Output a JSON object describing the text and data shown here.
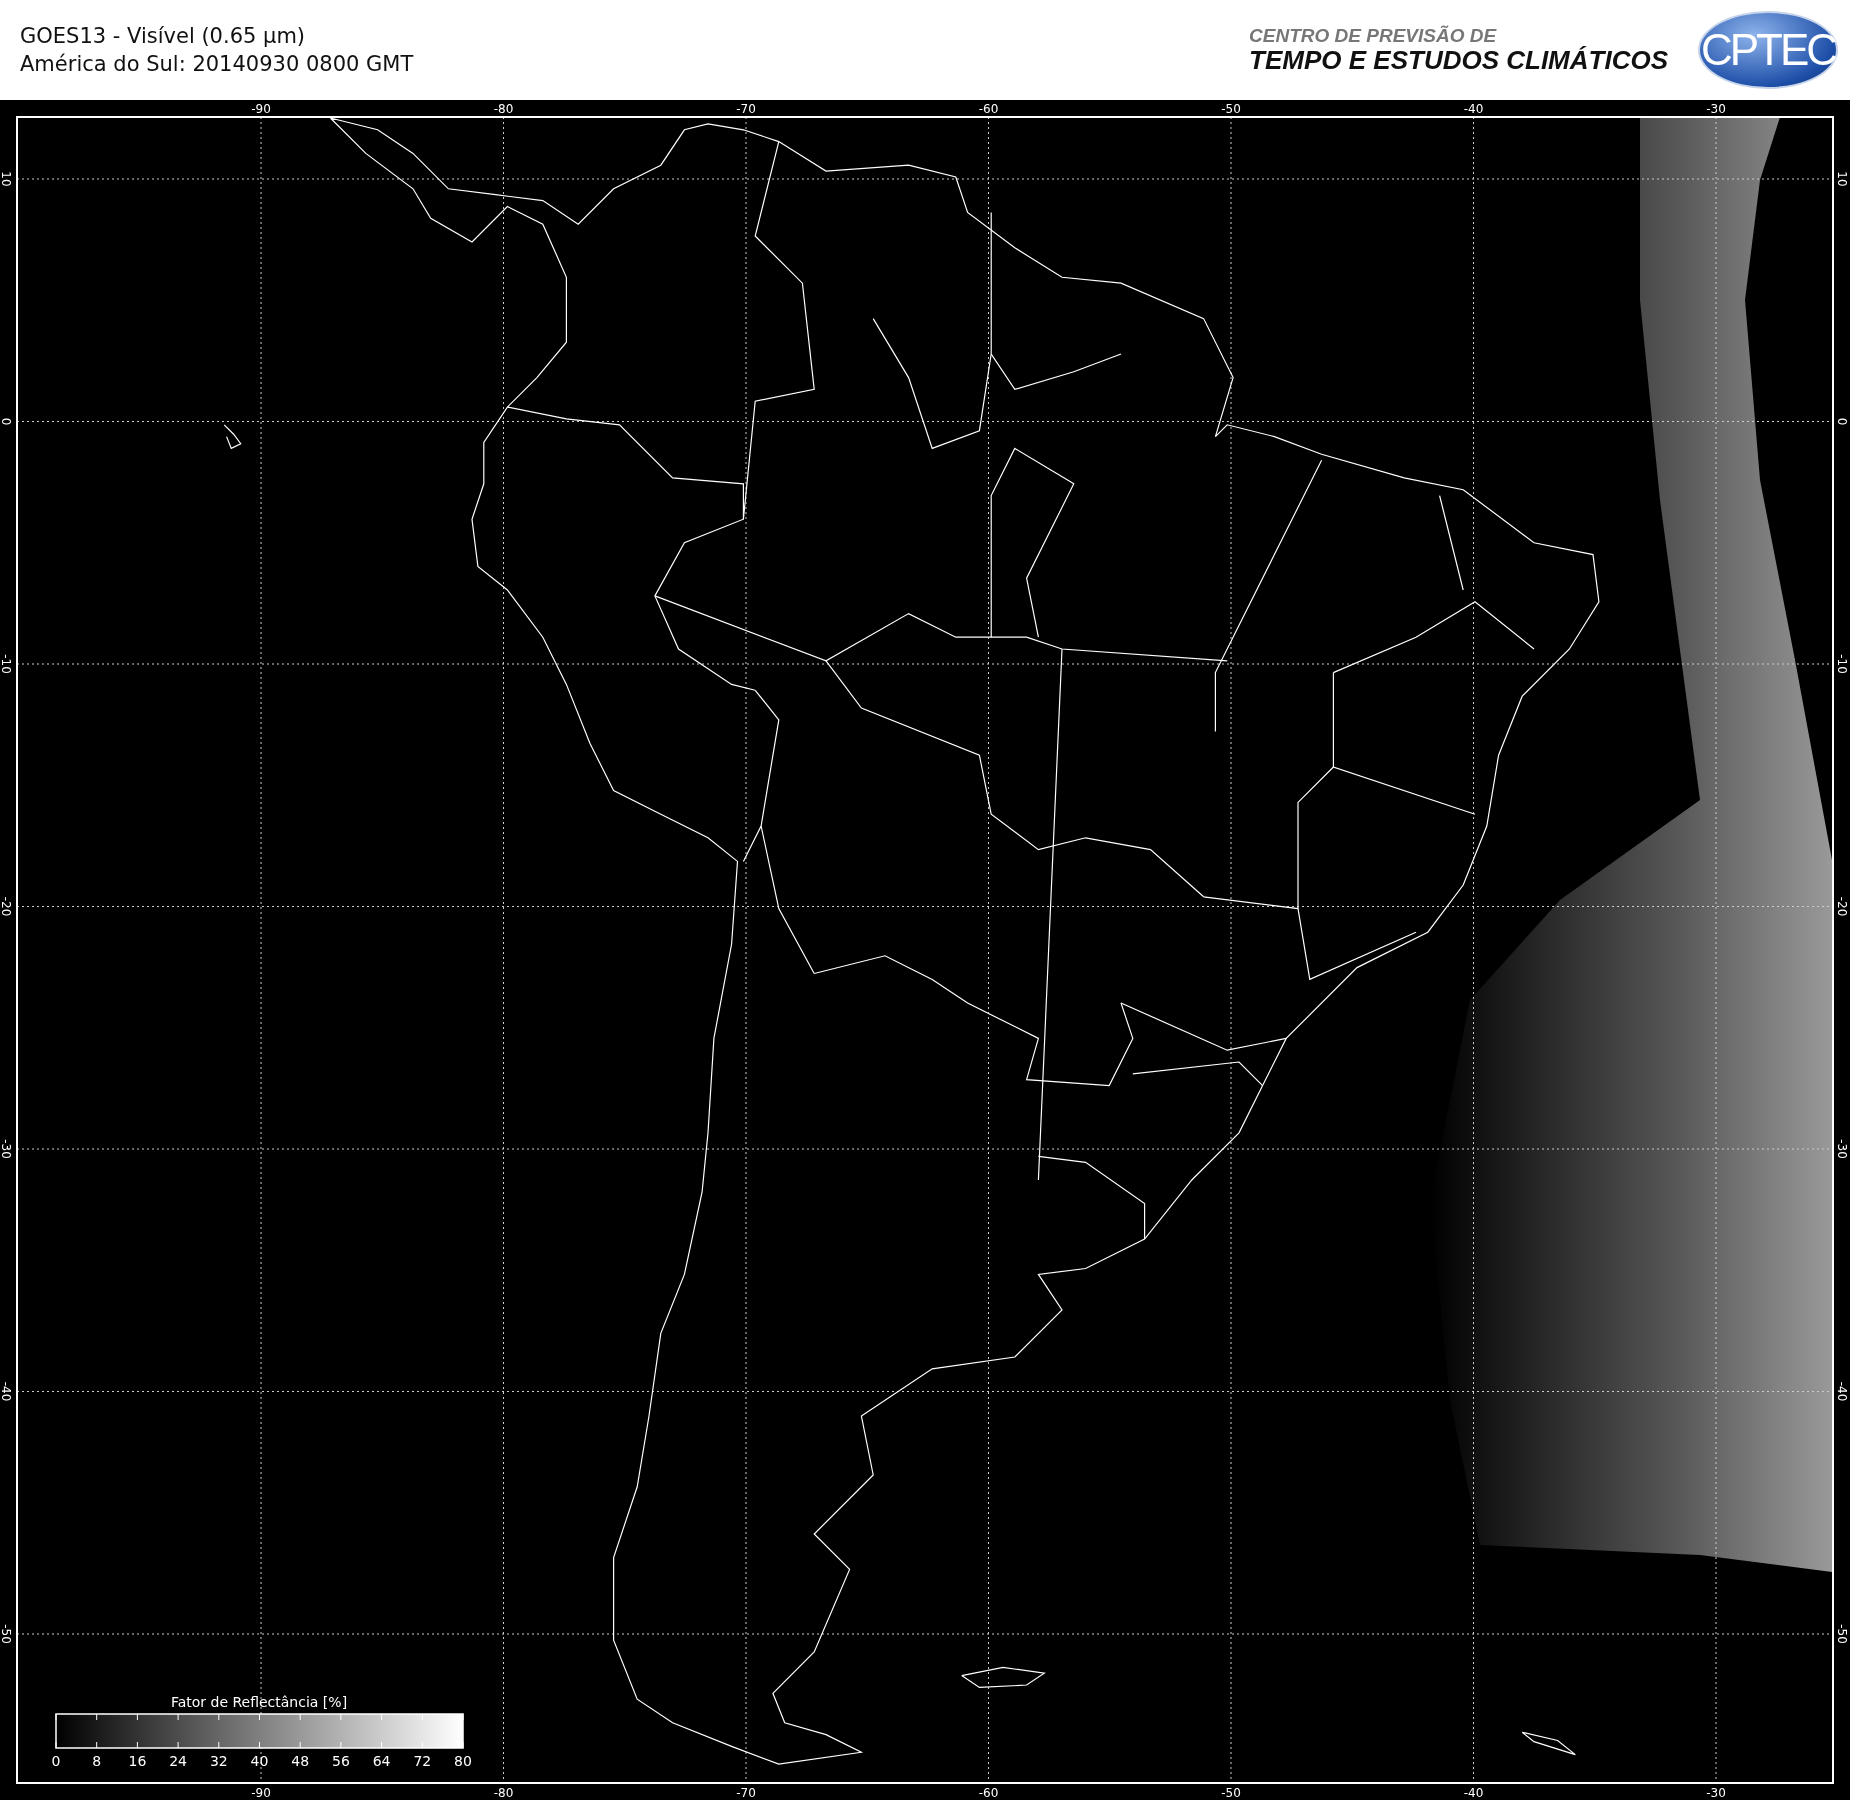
{
  "header": {
    "title": "GOES13 - Visível (0.65 µm)",
    "subtitle": "América do Sul: 20140930 0800 GMT",
    "org_line1": "CENTRO DE PREVISÃO DE",
    "org_line2": "TEMPO E ESTUDOS CLIMÁTICOS",
    "logo_text": "CPTEC"
  },
  "map": {
    "top_labels": [
      "-90",
      "-80",
      "-70",
      "-60",
      "-50",
      "-40",
      "-30"
    ],
    "bottom_labels": [
      "-90",
      "-80",
      "-70",
      "-60",
      "-50",
      "-40",
      "-30"
    ],
    "left_labels": [
      "10",
      "0",
      "-10",
      "-20",
      "-30",
      "-40",
      "-50"
    ],
    "right_labels": [
      "10",
      "0",
      "-10",
      "-20",
      "-30",
      "-40",
      "-50"
    ]
  },
  "colorbar": {
    "title": "Fator de Reflectância [%]",
    "ticks": [
      "0",
      "8",
      "16",
      "24",
      "32",
      "40",
      "48",
      "56",
      "64",
      "72",
      "80"
    ]
  }
}
